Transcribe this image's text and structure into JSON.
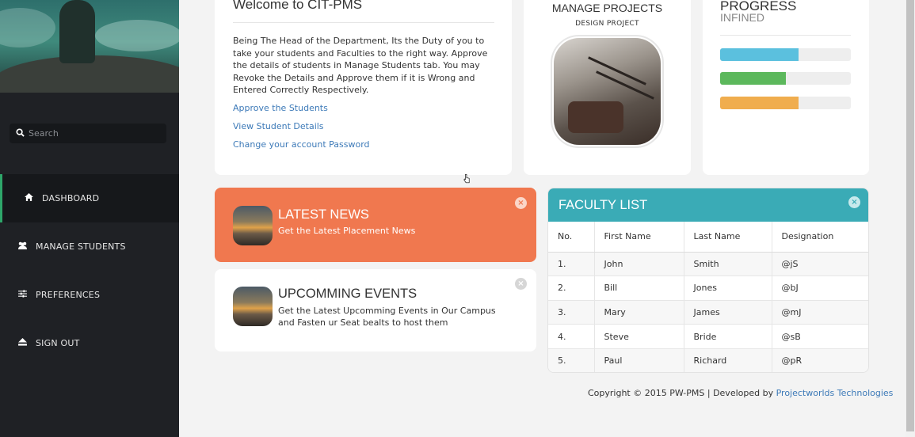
{
  "sidebar": {
    "search": {
      "placeholder": "Search"
    },
    "items": [
      {
        "label": "DASHBOARD",
        "icon": "home-icon"
      },
      {
        "label": "MANAGE STUDENTS",
        "icon": "users-icon"
      },
      {
        "label": "PREFERENCES",
        "icon": "sliders-icon"
      },
      {
        "label": "SIGN OUT",
        "icon": "eject-icon"
      }
    ]
  },
  "welcome": {
    "title": "Welcome to CIT-PMS",
    "body": "Being The Head of the Department, Its the Duty of you to take your students and Faculties to the right way. Approve the details of students in Manage Students tab. You may Revoke the Details and Approve them if it is Wrong and Entered Correctly Respectively.",
    "links": [
      "Approve the Students",
      "View Student Details",
      "Change your account Password"
    ]
  },
  "projects": {
    "title": "MANAGE PROJECTS",
    "subtitle": "DESIGN PROJECT"
  },
  "progress": {
    "title": "PROGRESS",
    "subtitle": "INFINED",
    "bars": [
      {
        "value": 0.6,
        "color": "#5bc0de"
      },
      {
        "value": 0.5,
        "color": "#5cb85c"
      },
      {
        "value": 0.6,
        "color": "#f0ad4e"
      }
    ]
  },
  "news": {
    "title": "LATEST NEWS",
    "subtitle": "Get the Latest Placement News",
    "close": "×",
    "color": "#f0784f"
  },
  "events": {
    "title": "UPCOMMING EVENTS",
    "subtitle": "Get the Latest Upcomming Events in Our Campus and Fasten ur Seat bealts to host them",
    "close": "×"
  },
  "faculty": {
    "title": "FACULTY LIST",
    "close": "×",
    "color": "#3aabb6",
    "columns": [
      "No.",
      "First Name",
      "Last Name",
      "Designation"
    ],
    "rows": [
      [
        "1.",
        "John",
        "Smith",
        "@jS"
      ],
      [
        "2.",
        "Bill",
        "Jones",
        "@bJ"
      ],
      [
        "3.",
        "Mary",
        "James",
        "@mJ"
      ],
      [
        "4.",
        "Steve",
        "Bride",
        "@sB"
      ],
      [
        "5.",
        "Paul",
        "Richard",
        "@pR"
      ]
    ]
  },
  "footer": {
    "copyright": "Copyright © 2015 PW-PMS | Developed by ",
    "link": "Projectworlds Technologies"
  }
}
